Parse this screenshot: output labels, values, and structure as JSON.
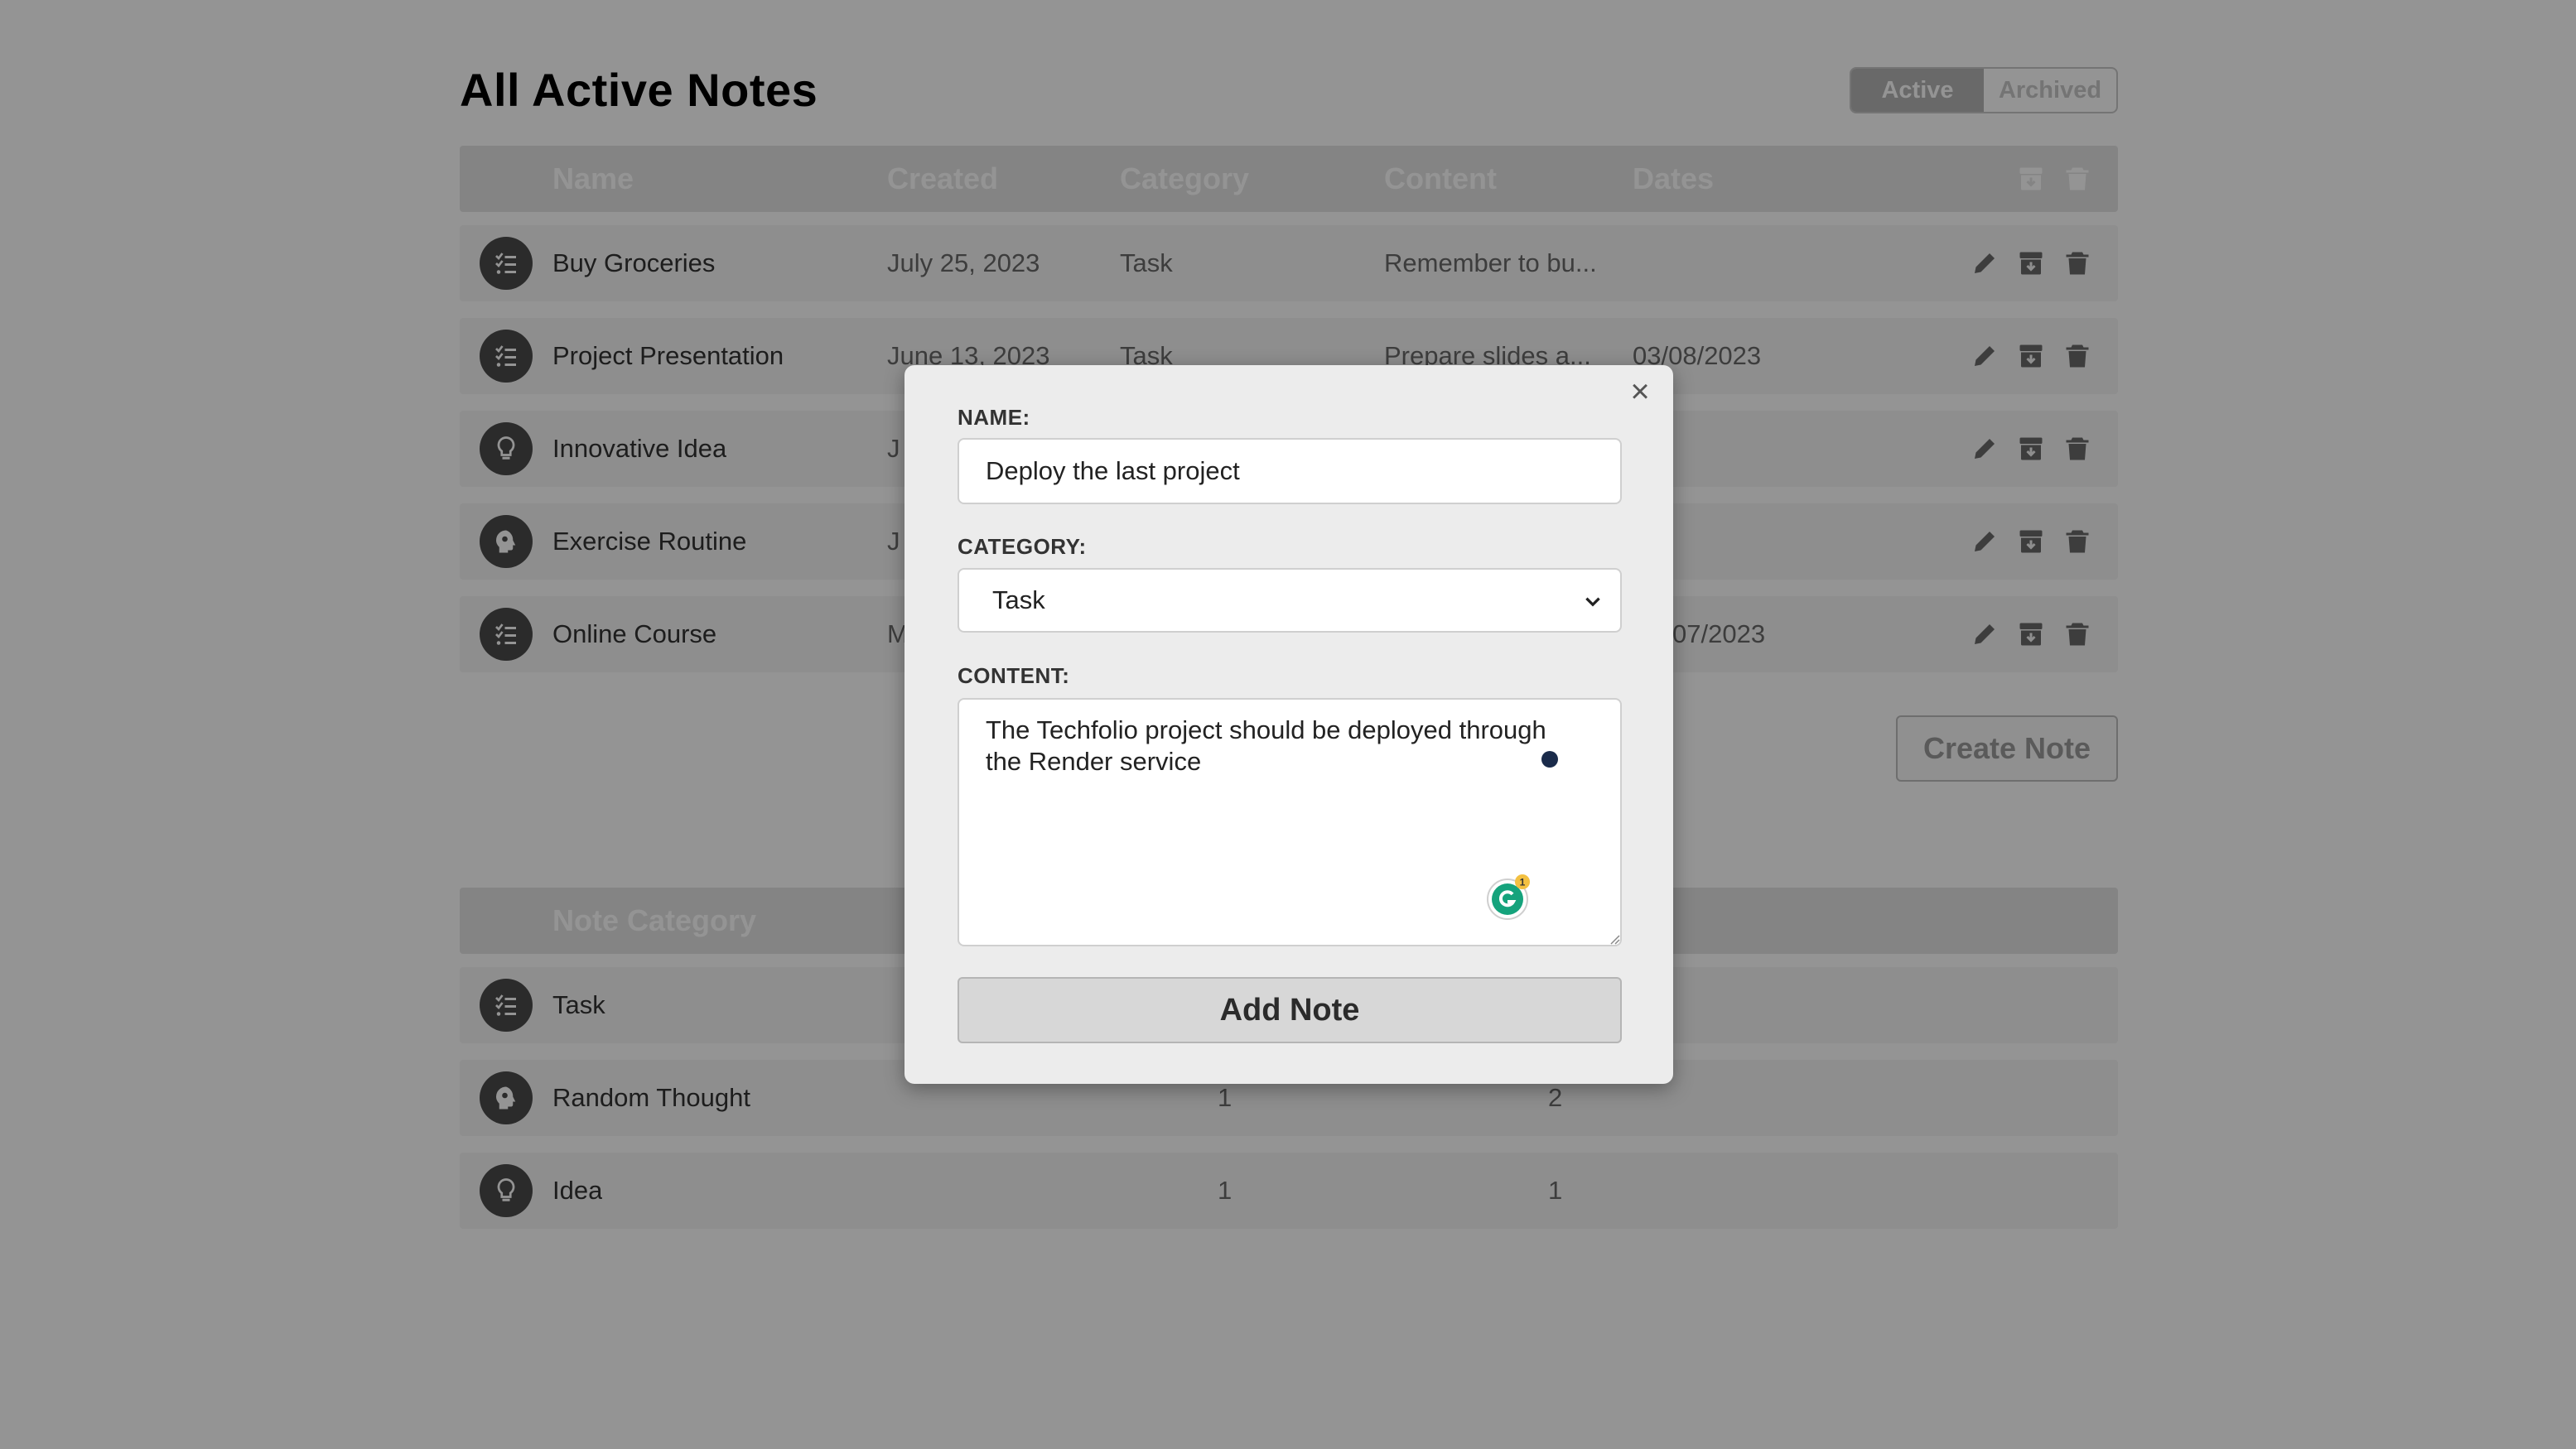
{
  "header": {
    "title": "All Active Notes",
    "toggle": {
      "active_label": "Active",
      "archived_label": "Archived",
      "selected": "Active"
    }
  },
  "notes_table": {
    "columns": [
      "Name",
      "Created",
      "Category",
      "Content",
      "Dates"
    ],
    "rows": [
      {
        "icon": "task-list-icon",
        "name": "Buy Groceries",
        "created": "July 25, 2023",
        "category": "Task",
        "content": "Remember to bu...",
        "dates": ""
      },
      {
        "icon": "task-list-icon",
        "name": "Project Presentation",
        "created": "June 13, 2023",
        "category": "Task",
        "content": "Prepare slides a...",
        "dates": "03/08/2023"
      },
      {
        "icon": "lightbulb-icon",
        "name": "Innovative Idea",
        "created": "J",
        "category": "",
        "content": "",
        "dates": ""
      },
      {
        "icon": "head-gear-icon",
        "name": "Exercise Routine",
        "created": "J",
        "category": "",
        "content": "",
        "dates": ""
      },
      {
        "icon": "task-list-icon",
        "name": "Online Course",
        "created": "M",
        "category": "",
        "content": "",
        "dates": "07/2023"
      }
    ]
  },
  "create_note_label": "Create Note",
  "summary_table": {
    "columns": [
      "Note Category"
    ],
    "rows": [
      {
        "icon": "task-list-icon",
        "category": "Task",
        "active": "",
        "archived": ""
      },
      {
        "icon": "head-gear-icon",
        "category": "Random Thought",
        "active": "1",
        "archived": "2"
      },
      {
        "icon": "lightbulb-icon",
        "category": "Idea",
        "active": "1",
        "archived": "1"
      }
    ]
  },
  "modal": {
    "close_glyph": "×",
    "name_label": "NAME:",
    "name_value": "Deploy the last project",
    "category_label": "CATEGORY:",
    "category_value": "Task",
    "content_label": "CONTENT:",
    "content_value": "The Techfolio project should be deployed through\nthe Render service",
    "grammarly_badge_count": "1",
    "submit_label": "Add Note"
  },
  "colors": {
    "header_bg": "#e3e3e3",
    "row_bg": "#f5f5f5",
    "icon_circle": "#4a4a4a",
    "overlay": "rgba(0,0,0,0.42)",
    "grammarly_green": "#15a37c",
    "grammarly_badge": "#f3c041"
  }
}
